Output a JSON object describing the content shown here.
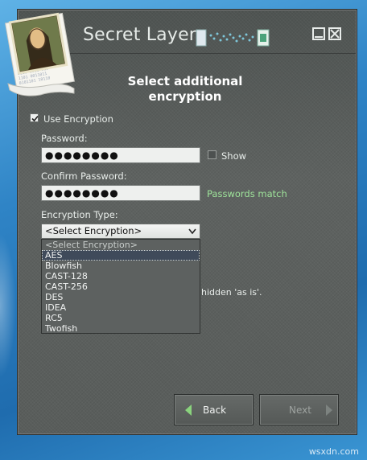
{
  "window": {
    "title": "Secret Layer",
    "minimize_icon": "minimize-icon",
    "close_icon": "close-icon"
  },
  "step": {
    "heading_line1": "Select additional",
    "heading_line2": "encryption"
  },
  "form": {
    "use_encryption": {
      "label": "Use Encryption",
      "checked": true
    },
    "password": {
      "label": "Password:",
      "value": "●●●●●●●●"
    },
    "show": {
      "label": "Show",
      "checked": false
    },
    "confirm_password": {
      "label": "Confirm Password:",
      "value": "●●●●●●●●"
    },
    "match_status": "Passwords match",
    "encryption_type": {
      "label": "Encryption Type:",
      "selected": "<Select Encryption>",
      "options": [
        "<Select Encryption>",
        "AES",
        "Blowfish",
        "CAST-128",
        "CAST-256",
        "DES",
        "IDEA",
        "RC5",
        "Twofish"
      ],
      "highlighted": "AES"
    },
    "partial_hint": "hidden 'as is'."
  },
  "nav": {
    "back_label": "Back",
    "next_label": "Next"
  },
  "watermark": "wsxdn.com",
  "colors": {
    "window_bg": "#5b5f5d",
    "match_text": "#9ee39a",
    "desktop_blue": "#2f84c6"
  }
}
